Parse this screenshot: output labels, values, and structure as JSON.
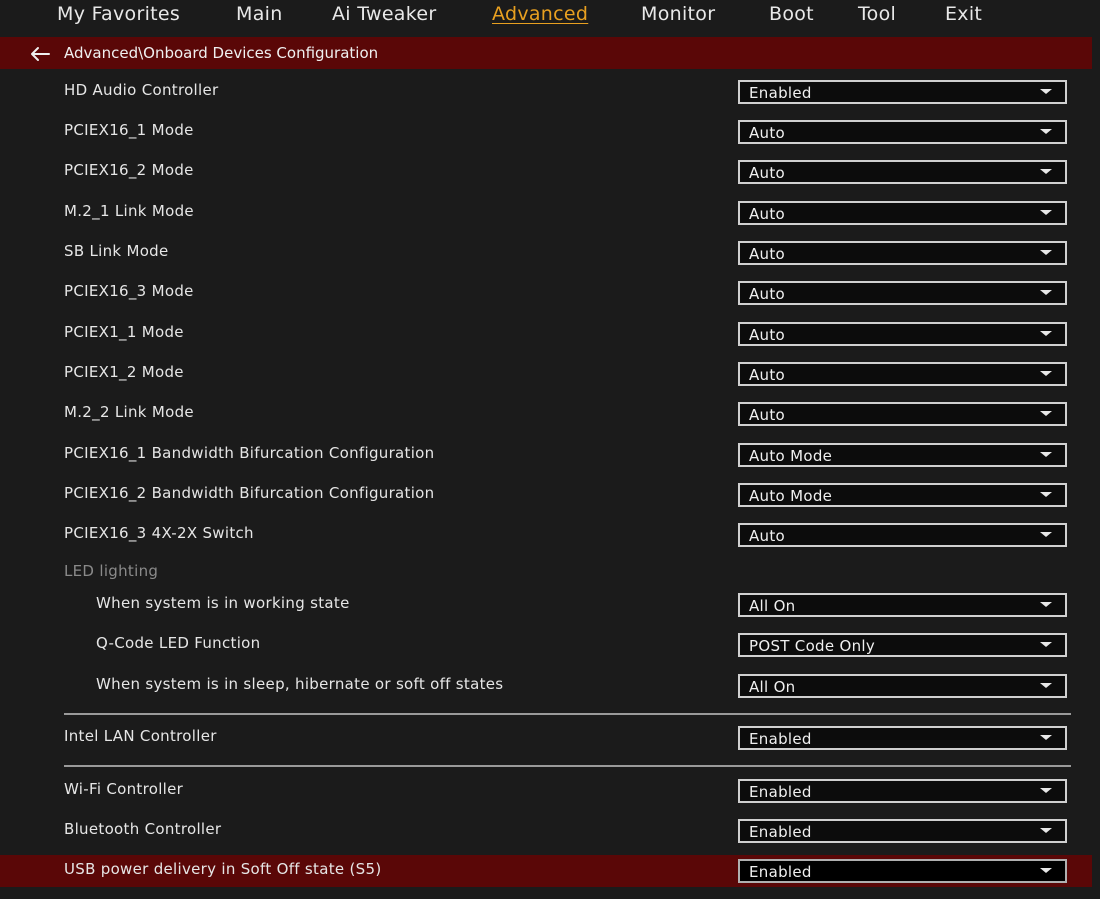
{
  "nav": {
    "tabs": [
      {
        "label": "My Favorites"
      },
      {
        "label": "Main"
      },
      {
        "label": "Ai Tweaker"
      },
      {
        "label": "Advanced"
      },
      {
        "label": "Monitor"
      },
      {
        "label": "Boot"
      },
      {
        "label": "Tool"
      },
      {
        "label": "Exit"
      }
    ],
    "active_tab": "Advanced"
  },
  "breadcrumb": {
    "path": "Advanced\\Onboard Devices Configuration",
    "back_icon": "arrow-left-icon"
  },
  "settings": [
    {
      "label": "HD Audio Controller",
      "value": "Enabled"
    },
    {
      "label": "PCIEX16_1 Mode",
      "value": "Auto"
    },
    {
      "label": "PCIEX16_2 Mode",
      "value": "Auto"
    },
    {
      "label": "M.2_1 Link Mode",
      "value": "Auto"
    },
    {
      "label": "SB Link Mode",
      "value": "Auto"
    },
    {
      "label": "PCIEX16_3 Mode",
      "value": "Auto"
    },
    {
      "label": "PCIEX1_1 Mode",
      "value": "Auto"
    },
    {
      "label": "PCIEX1_2 Mode",
      "value": "Auto"
    },
    {
      "label": "M.2_2 Link Mode",
      "value": "Auto"
    },
    {
      "label": "PCIEX16_1 Bandwidth Bifurcation Configuration",
      "value": "Auto Mode"
    },
    {
      "label": "PCIEX16_2 Bandwidth Bifurcation Configuration",
      "value": "Auto Mode"
    },
    {
      "label": "PCIEX16_3 4X-2X Switch",
      "value": "Auto"
    }
  ],
  "led_section": {
    "heading": "LED lighting",
    "settings": [
      {
        "label": "When system is in working state",
        "value": "All On"
      },
      {
        "label": "Q-Code LED Function",
        "value": "POST Code Only"
      },
      {
        "label": "When system is in sleep, hibernate or soft off states",
        "value": "All On"
      }
    ]
  },
  "lan": {
    "label": "Intel LAN Controller",
    "value": "Enabled"
  },
  "wireless": [
    {
      "label": "Wi-Fi Controller",
      "value": "Enabled"
    },
    {
      "label": "Bluetooth Controller",
      "value": "Enabled"
    },
    {
      "label": "USB power delivery in Soft Off state (S5)",
      "value": "Enabled",
      "selected": true
    }
  ],
  "colors": {
    "background": "#1b1b1b",
    "accent_red": "#5a0707",
    "active_tab": "#e8a020",
    "text": "#e6e6e6",
    "section_heading": "#8a8a8a"
  }
}
